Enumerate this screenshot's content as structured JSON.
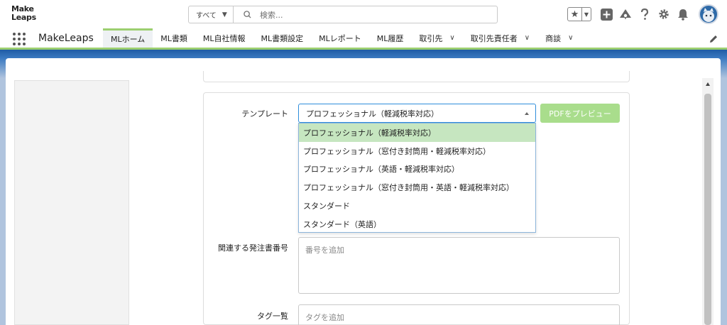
{
  "header": {
    "logo_line1": "Make",
    "logo_line2": "Leaps",
    "search_scope": "すべて",
    "search_placeholder": "検索..."
  },
  "nav": {
    "app_name": "MakeLeaps",
    "tabs": [
      {
        "label": "MLホーム",
        "active": true
      },
      {
        "label": "ML書類"
      },
      {
        "label": "ML自社情報"
      },
      {
        "label": "ML書類設定"
      },
      {
        "label": "MLレポート"
      },
      {
        "label": "ML履歴"
      },
      {
        "label": "取引先",
        "dropdown": true
      },
      {
        "label": "取引先責任者",
        "dropdown": true
      },
      {
        "label": "商談",
        "dropdown": true
      }
    ]
  },
  "form": {
    "template_label": "テンプレート",
    "template_value": "プロフェッショナル（軽減税率対応）",
    "preview_button": "PDFをプレビュー",
    "template_options": [
      "プロフェッショナル（軽減税率対応）",
      "プロフェッショナル（窓付き封筒用・軽減税率対応）",
      "プロフェッショナル（英語・軽減税率対応）",
      "プロフェッショナル（窓付き封筒用・英語・軽減税率対応）",
      "スタンダード",
      "スタンダード（英語）"
    ],
    "po_label": "関連する発注書番号",
    "po_placeholder": "番号を追加",
    "tags_label": "タグ一覧",
    "tags_placeholder": "タグを追加"
  },
  "colors": {
    "accent_green": "#9ccf70",
    "selected_option": "#c6e6c0",
    "focus_blue": "#2e8ddb",
    "brand_blue": "#1f5ca5"
  }
}
